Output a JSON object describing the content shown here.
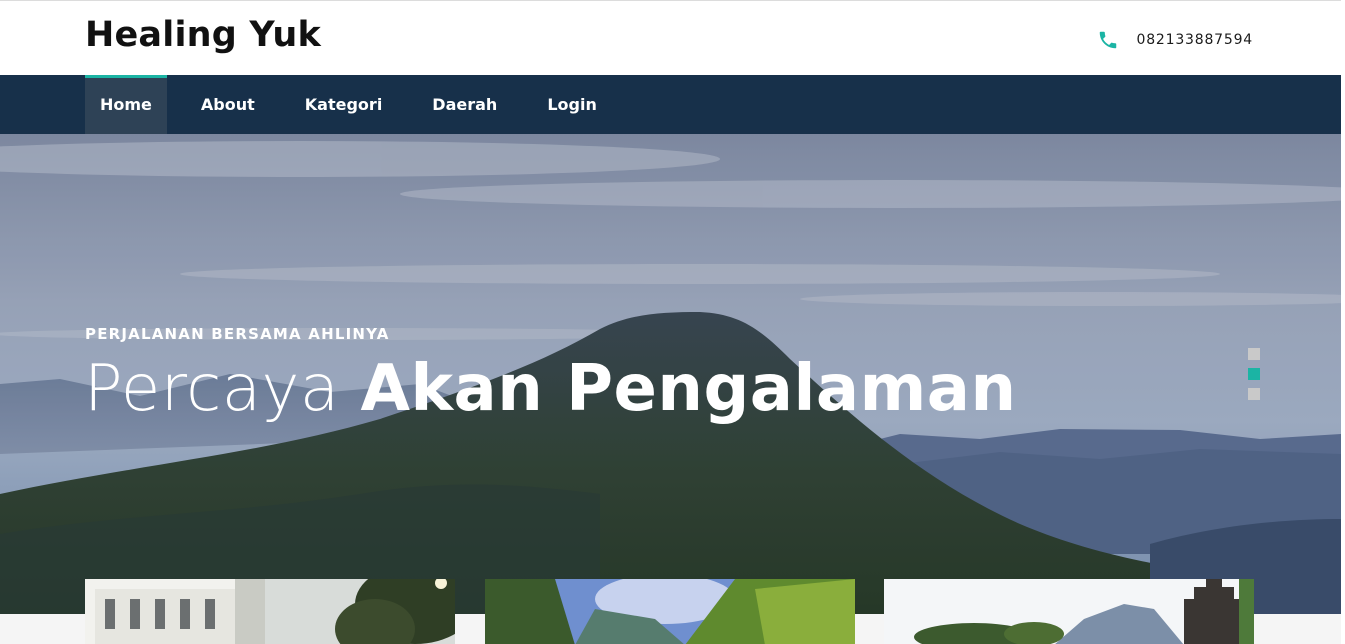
{
  "header": {
    "brand": "Healing Yuk",
    "phone_icon": "phone-icon",
    "phone_number": "082133887594"
  },
  "nav": {
    "items": [
      {
        "label": "Home",
        "active": true
      },
      {
        "label": "About",
        "active": false
      },
      {
        "label": "Kategori",
        "active": false
      },
      {
        "label": "Daerah",
        "active": false
      },
      {
        "label": "Login",
        "active": false
      }
    ]
  },
  "hero": {
    "kicker": "PERJALANAN BERSAMA AHLINYA",
    "title_light": "Percaya",
    "title_bold": "Akan Pengalaman",
    "slides": 3,
    "active_slide_index": 1
  },
  "colors": {
    "nav_bg": "#17304a",
    "accent": "#1bb4a4",
    "nav_active_bg": "#2e4256"
  },
  "cards": [
    {
      "icon": "building-photo"
    },
    {
      "icon": "waterfall-photo"
    },
    {
      "icon": "temple-photo"
    }
  ]
}
